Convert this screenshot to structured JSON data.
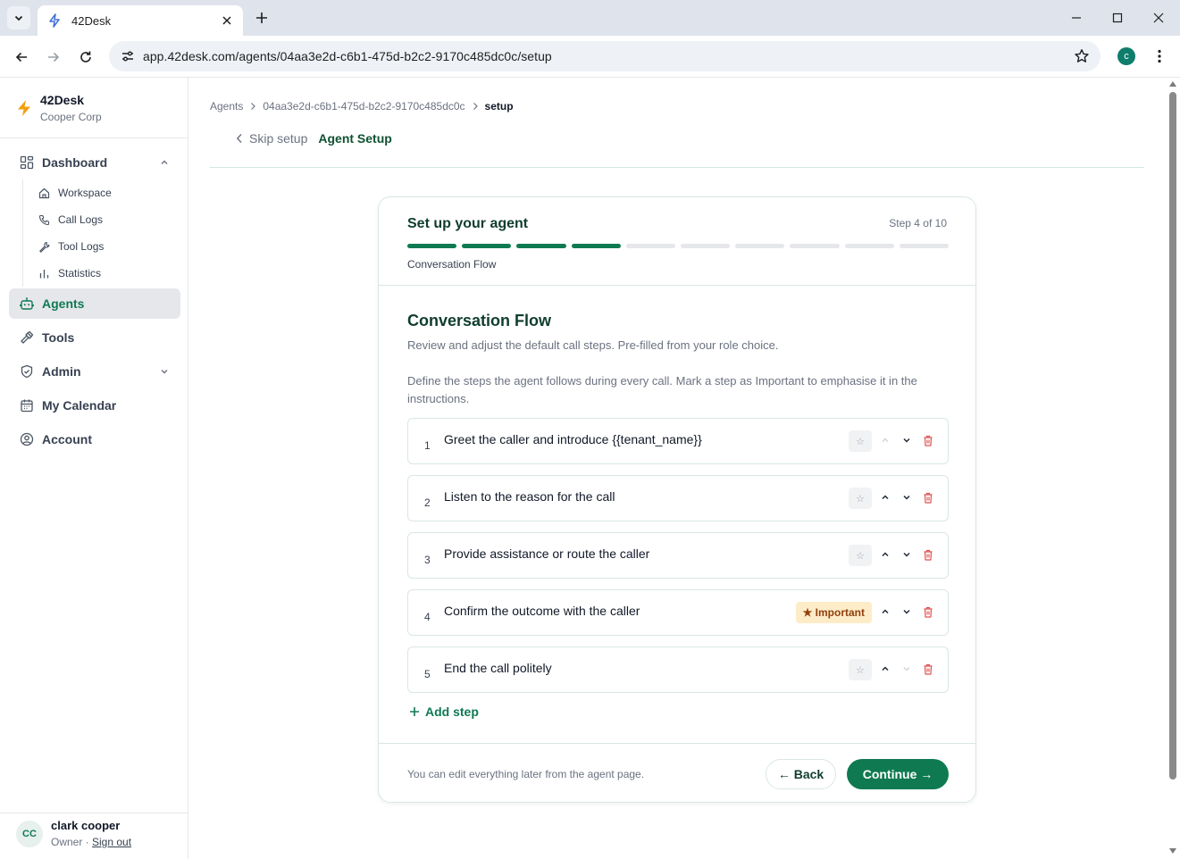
{
  "browser": {
    "tab_title": "42Desk",
    "url": "app.42desk.com/agents/04aa3e2d-c6b1-475d-b2c2-9170c485dc0c/setup",
    "profile_initial": "c"
  },
  "sidebar": {
    "brand_name": "42Desk",
    "org_name": "Cooper Corp",
    "dashboard_label": "Dashboard",
    "sub_items": [
      {
        "label": "Workspace",
        "icon": "home-icon"
      },
      {
        "label": "Call Logs",
        "icon": "phone-icon"
      },
      {
        "label": "Tool Logs",
        "icon": "tool-icon"
      },
      {
        "label": "Statistics",
        "icon": "chart-icon"
      }
    ],
    "agents_label": "Agents",
    "tools_label": "Tools",
    "admin_label": "Admin",
    "calendar_label": "My Calendar",
    "account_label": "Account",
    "user": {
      "initials": "CC",
      "name": "clark cooper",
      "role": "Owner",
      "role_sep": " · ",
      "signout": "Sign out"
    }
  },
  "breadcrumb": {
    "items": [
      "Agents",
      "04aa3e2d-c6b1-475d-b2c2-9170c485dc0c",
      "setup"
    ]
  },
  "header": {
    "skip_label": "Skip setup",
    "title": "Agent Setup"
  },
  "card": {
    "title": "Set up your agent",
    "step_text": "Step 4 of 10",
    "progress": {
      "current": 4,
      "total": 10
    },
    "subtitle": "Conversation Flow",
    "section_title": "Conversation Flow",
    "section_desc": "Review and adjust the default call steps. Pre-filled from your role choice.",
    "section_help": "Define the steps the agent follows during every call. Mark a step as Important to emphasise it in the instructions.",
    "steps": [
      {
        "number": "1",
        "text": "Greet the caller and introduce {{tenant_name}}",
        "important": false
      },
      {
        "number": "2",
        "text": "Listen to the reason for the call",
        "important": false
      },
      {
        "number": "3",
        "text": "Provide assistance or route the caller",
        "important": false
      },
      {
        "number": "4",
        "text": "Confirm the outcome with the caller",
        "important": true
      },
      {
        "number": "5",
        "text": "End the call politely",
        "important": false
      }
    ],
    "star_glyph": "☆",
    "important_label": "★ Important",
    "add_step_label": "Add step",
    "footnote": "You can edit everything later from the agent page.",
    "back_label": "← Back",
    "continue_label": "Continue →"
  },
  "colors": {
    "accent": "#0f7a52",
    "important_bg": "#fdecc8",
    "delete": "#e05252"
  }
}
